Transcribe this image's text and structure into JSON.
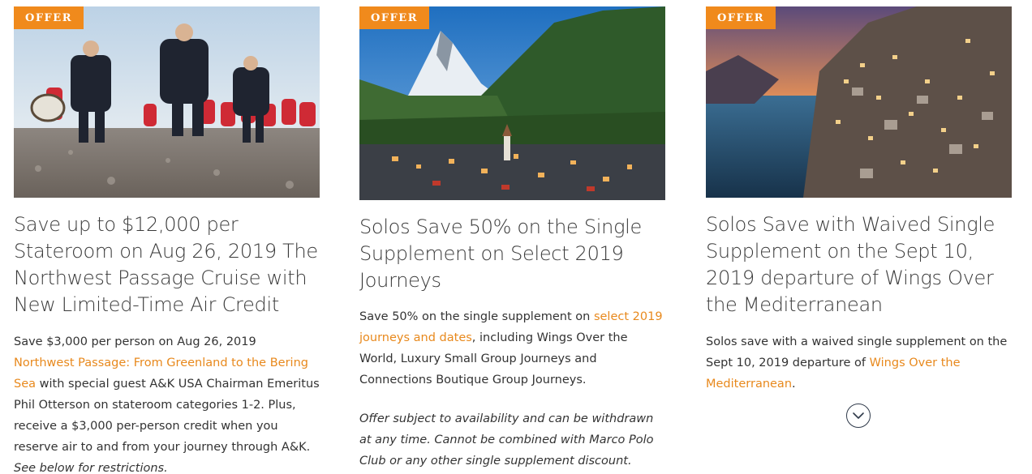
{
  "offers": [
    {
      "badge": "OFFER",
      "title": "Save up to $12,000 per Stateroom on Aug 26, 2019 The Northwest Passage Cruise with New Limited-Time Air Credit",
      "body_pre": "Save $3,000 per person on Aug 26, 2019 ",
      "body_link": "Northwest Passage: From Greenland to the Bering Sea",
      "body_post": " with special guest A&K USA Chairman Emeritus Phil Otterson on stateroom categories 1-2. Plus, receive a $3,000 per-person credit when you reserve air to and from your journey through A&K. ",
      "body_italic": "See below for restrictions."
    },
    {
      "badge": "OFFER",
      "title": "Solos Save 50% on the Single Supplement on Select 2019 Journeys",
      "body_pre": "Save 50% on the single supplement on ",
      "body_link": "select 2019 journeys and dates",
      "body_post": ", including Wings Over the World, Luxury Small Group Journeys and Connections Boutique Group Journeys.",
      "note": "Offer subject to availability and can be withdrawn at any time. Cannot be combined with Marco Polo Club or any other single supplement discount."
    },
    {
      "badge": "OFFER",
      "title": "Solos Save with Waived Single Supplement on the Sept 10, 2019 departure of Wings Over the Mediterranean",
      "body_pre": "Solos save with a waived single supplement on the Sept 10, 2019 departure of ",
      "body_link": "Wings Over the Mediterranean",
      "body_post": "."
    }
  ],
  "icons": {
    "expand": "chevron-down-icon"
  },
  "colors": {
    "accent": "#f08a1c",
    "link": "#e8891d",
    "text": "#333333"
  }
}
